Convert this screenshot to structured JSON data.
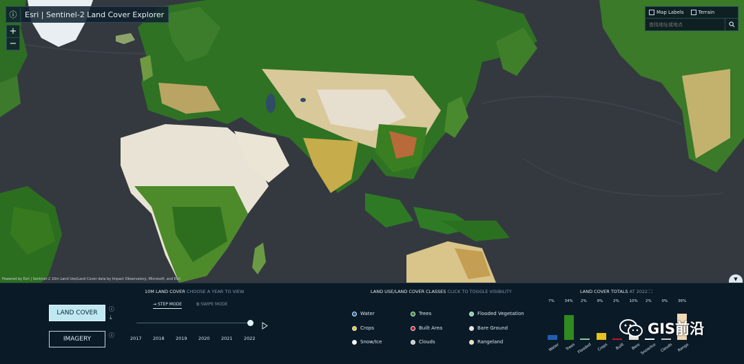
{
  "app": {
    "title": "Esri | Sentinel-2 Land Cover Explorer",
    "info_icon": "info-icon"
  },
  "zoom": {
    "in_label": "+",
    "out_label": "−"
  },
  "map_options": {
    "map_labels": "Map Labels",
    "terrain": "Terrain",
    "search_placeholder": "查找地址或地点",
    "search_icon": "search-icon"
  },
  "attribution": "Powered by Esri | Sentinel-2 10m Land Use/Land Cover data by Impact Observatory, Microsoft, and Esri",
  "layer_buttons": {
    "land_cover": "LAND COVER",
    "imagery": "IMAGERY"
  },
  "time_section": {
    "title": "10M LAND COVER",
    "subtitle": "CHOOSE A YEAR TO VIEW",
    "step_mode": "STEP MODE",
    "swipe_mode": "SWIPE MODE",
    "years": [
      "2017",
      "2018",
      "2019",
      "2020",
      "2021",
      "2022"
    ],
    "selected_year": "2022"
  },
  "classes_section": {
    "title": "LAND USE/LAND COVER CLASSES",
    "subtitle": "CLICK TO TOGGLE VISIBILITY",
    "items": [
      {
        "label": "Water",
        "color": "#1f5fb0"
      },
      {
        "label": "Trees",
        "color": "#2f8a1f"
      },
      {
        "label": "Flooded Vegetation",
        "color": "#86c99a"
      },
      {
        "label": "Crops",
        "color": "#e8c21c"
      },
      {
        "label": "Built Area",
        "color": "#c8101f"
      },
      {
        "label": "Bare Ground",
        "color": "#e4e2dc"
      },
      {
        "label": "Snow/Ice",
        "color": "#f5f9fb"
      },
      {
        "label": "Clouds",
        "color": "#c9c9c9"
      },
      {
        "label": "Rangeland",
        "color": "#f0d9b6"
      }
    ]
  },
  "totals_section": {
    "title": "LAND COVER TOTALS",
    "subtitle": "AT 2022",
    "expand_icon": "expand-icon"
  },
  "chart_data": {
    "type": "bar",
    "categories": [
      "Water",
      "Trees",
      "Flooded",
      "Crops",
      "Built",
      "Bare",
      "Snow/Ice",
      "Clouds",
      "Range"
    ],
    "values": [
      7,
      34,
      2,
      9,
      2,
      10,
      2,
      0,
      36
    ],
    "value_labels": [
      "7%",
      "34%",
      "2%",
      "9%",
      "2%",
      "10%",
      "2%",
      "0%",
      "36%"
    ],
    "colors": [
      "#1f5fb0",
      "#2f8a1f",
      "#86c99a",
      "#e8c21c",
      "#c8101f",
      "#e4e2dc",
      "#f5f9fb",
      "#c9c9c9",
      "#f0d9b6"
    ],
    "ylim": [
      0,
      36
    ]
  },
  "watermark": {
    "text": "GIS前沿"
  }
}
